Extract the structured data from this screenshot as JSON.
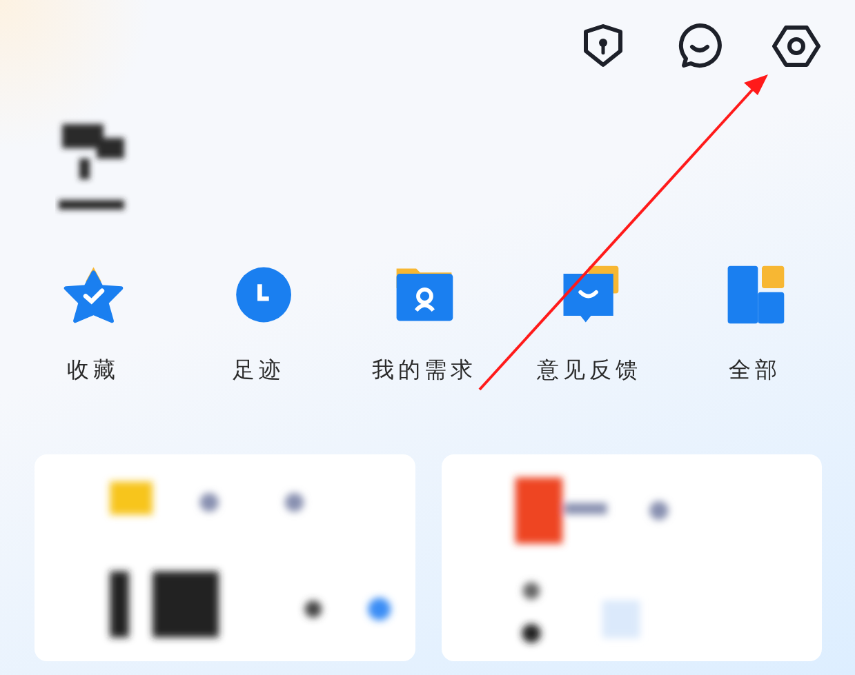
{
  "header": {
    "icons": [
      {
        "kind": "privacy"
      },
      {
        "kind": "chat"
      },
      {
        "kind": "settings"
      }
    ]
  },
  "shortcuts": [
    {
      "kind": "star",
      "label": "收藏"
    },
    {
      "kind": "clock",
      "label": "足迹"
    },
    {
      "kind": "folder",
      "label": "我的需求"
    },
    {
      "kind": "feedback",
      "label": "意见反馈"
    },
    {
      "kind": "grid",
      "label": "全部"
    }
  ],
  "cards": [
    {
      "kind": "left"
    },
    {
      "kind": "right"
    }
  ]
}
